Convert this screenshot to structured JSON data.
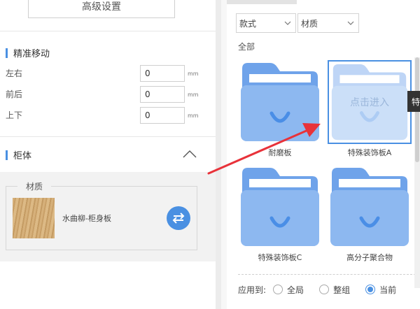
{
  "left": {
    "advanced_button": "高级设置",
    "precise_move": {
      "title": "精准移动",
      "rows": [
        {
          "label": "左右",
          "value": "0",
          "unit": "mm"
        },
        {
          "label": "前后",
          "value": "0",
          "unit": "mm"
        },
        {
          "label": "上下",
          "value": "0",
          "unit": "mm"
        }
      ]
    },
    "cabinet": {
      "title": "柜体",
      "material_legend": "材质",
      "material_name": "水曲柳-柜身板"
    }
  },
  "right": {
    "filters": {
      "style": "款式",
      "material": "材质"
    },
    "all_label": "全部",
    "tiles": [
      {
        "label": "耐磨板"
      },
      {
        "label": "特殊装饰板A",
        "overlay": "点击进入"
      },
      {
        "label": "特殊装饰板C"
      },
      {
        "label": "高分子聚合物"
      }
    ],
    "tooltip": "特",
    "apply": {
      "label": "应用到:",
      "options": [
        {
          "label": "全局",
          "selected": false
        },
        {
          "label": "整组",
          "selected": false
        },
        {
          "label": "当前",
          "selected": true
        }
      ]
    }
  },
  "colors": {
    "accent": "#4a90e2",
    "arrow": "#e8323a",
    "folder": "#8db8f0"
  },
  "icons": {
    "folder": "folder-icon",
    "swap": "swap-icon",
    "chevron": "chevron-down-icon",
    "collapse": "chevron-up-icon"
  }
}
